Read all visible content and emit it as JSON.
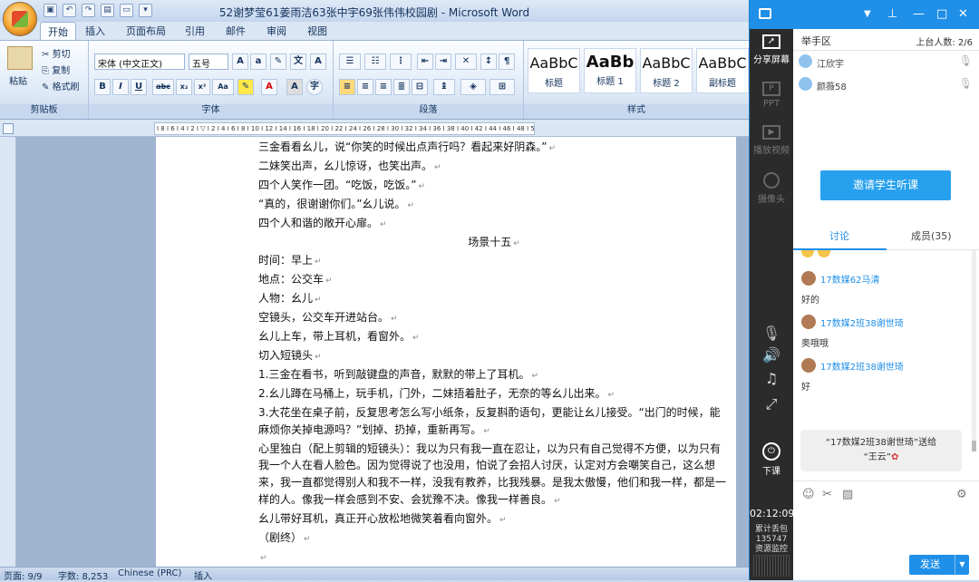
{
  "word": {
    "title": "52谢梦莹61姜雨洁63张中宇69张伟伟校园剧 - Microsoft Word",
    "tabs": [
      "开始",
      "插入",
      "页面布局",
      "引用",
      "邮件",
      "审阅",
      "视图"
    ],
    "clipboard": {
      "paste": "粘贴",
      "cut": "剪切",
      "copy": "复制",
      "format_painter": "格式刷",
      "label": "剪贴板"
    },
    "font": {
      "name": "宋体 (中文正文)",
      "size": "五号",
      "label": "字体"
    },
    "paragraph": {
      "label": "段落"
    },
    "styles": {
      "label": "样式",
      "items": [
        {
          "preview": "AaBbC",
          "name": "标题"
        },
        {
          "preview": "AaBb",
          "name": "标题 1"
        },
        {
          "preview": "AaBbC",
          "name": "标题 2"
        },
        {
          "preview": "AaBbC",
          "name": "副标题"
        }
      ]
    },
    "ruler_text": "I 8 I 6 I 4 I 2 I ▽ I 2 I 4 I 6 I 8 I 10 I 12 I 14 I 16 I 18 I 20 I 22 I 24 I 26 I 28 I 30 I 32 I 34 I 36 I 38 I 40 I 42 I 44 I 46 I 48 I 50 I 52",
    "document_lines": [
      "三金看看幺儿，说“你笑的时候出点声行吗？看起来好阴森。”",
      "二妹笑出声，幺儿惊讶，也笑出声。",
      "四个人笑作一团。“吃饭，吃饭。”",
      "“真的，很谢谢你们。”幺儿说。",
      "四个人和谐的敞开心扉。",
      "场景十五",
      "时间：早上",
      "地点：公交车",
      "人物：幺儿",
      "空镜头，公交车开进站台。",
      "幺儿上车，带上耳机，看窗外。",
      "切入短镜头",
      "1.三金在看书，听到敲键盘的声音，默默的带上了耳机。",
      "2.幺儿蹲在马桶上，玩手机，门外，二妹捂着肚子，无奈的等幺儿出来。",
      "3.大花坐在桌子前，反复思考怎么写小纸条，反复斟酌语句，更能让幺儿接受。“出门的时候，能麻烦你关掉电源吗？”划掉、扔掉，重新再写。",
      "心里独白（配上剪辑的短镜头）：我以为只有我一直在忍让，以为只有自己觉得不方便，以为只有我一个人在看人脸色。因为觉得说了也没用，怕说了会招人讨厌，认定对方会嘲笑自己，这么想来，我一直都觉得别人和我不一样，没我有教养，比我残暴。是我太傲慢，他们和我一样，都是一样的人。像我一样会感到不安、会犹豫不决。像我一样善良。",
      "幺儿带好耳机，真正开心放松地微笑着看向窗外。",
      "（剧终）",
      "",
      ""
    ],
    "status": {
      "page": "页面: 9/9",
      "words": "字数: 8,253",
      "lang": "Chinese (PRC)",
      "mode": "插入"
    }
  },
  "panel": {
    "side": [
      {
        "label": "分享屏幕",
        "icon": "share-screen-icon"
      },
      {
        "label": "PPT",
        "icon": "ppt-icon"
      },
      {
        "label": "播放视频",
        "icon": "video-icon"
      },
      {
        "label": "摄像头",
        "icon": "camera-icon"
      },
      {
        "label": "下课",
        "icon": "end-class-icon"
      }
    ],
    "hands": {
      "title": "举手区",
      "count": "上台人数: 2/6",
      "students": [
        "江欣宇",
        "颜薇58"
      ]
    },
    "invite": "邀请学生听课",
    "tabs": {
      "discuss": "讨论",
      "members": "成员(35)"
    },
    "messages": [
      {
        "name": "17数媒62马清",
        "text": "好的"
      },
      {
        "name": "17数媒2班38谢世琦",
        "text": "奥哦哦"
      },
      {
        "name": "17数媒2班38谢世琦",
        "text": "好"
      }
    ],
    "gift": {
      "line1": "“17数媒2班38谢世琦”送给",
      "line2": "“王云”"
    },
    "timer": "02:12:09",
    "stats": {
      "line1": "累计丢包",
      "line2": "135747",
      "line3": "资源监控"
    },
    "send": "发送"
  }
}
